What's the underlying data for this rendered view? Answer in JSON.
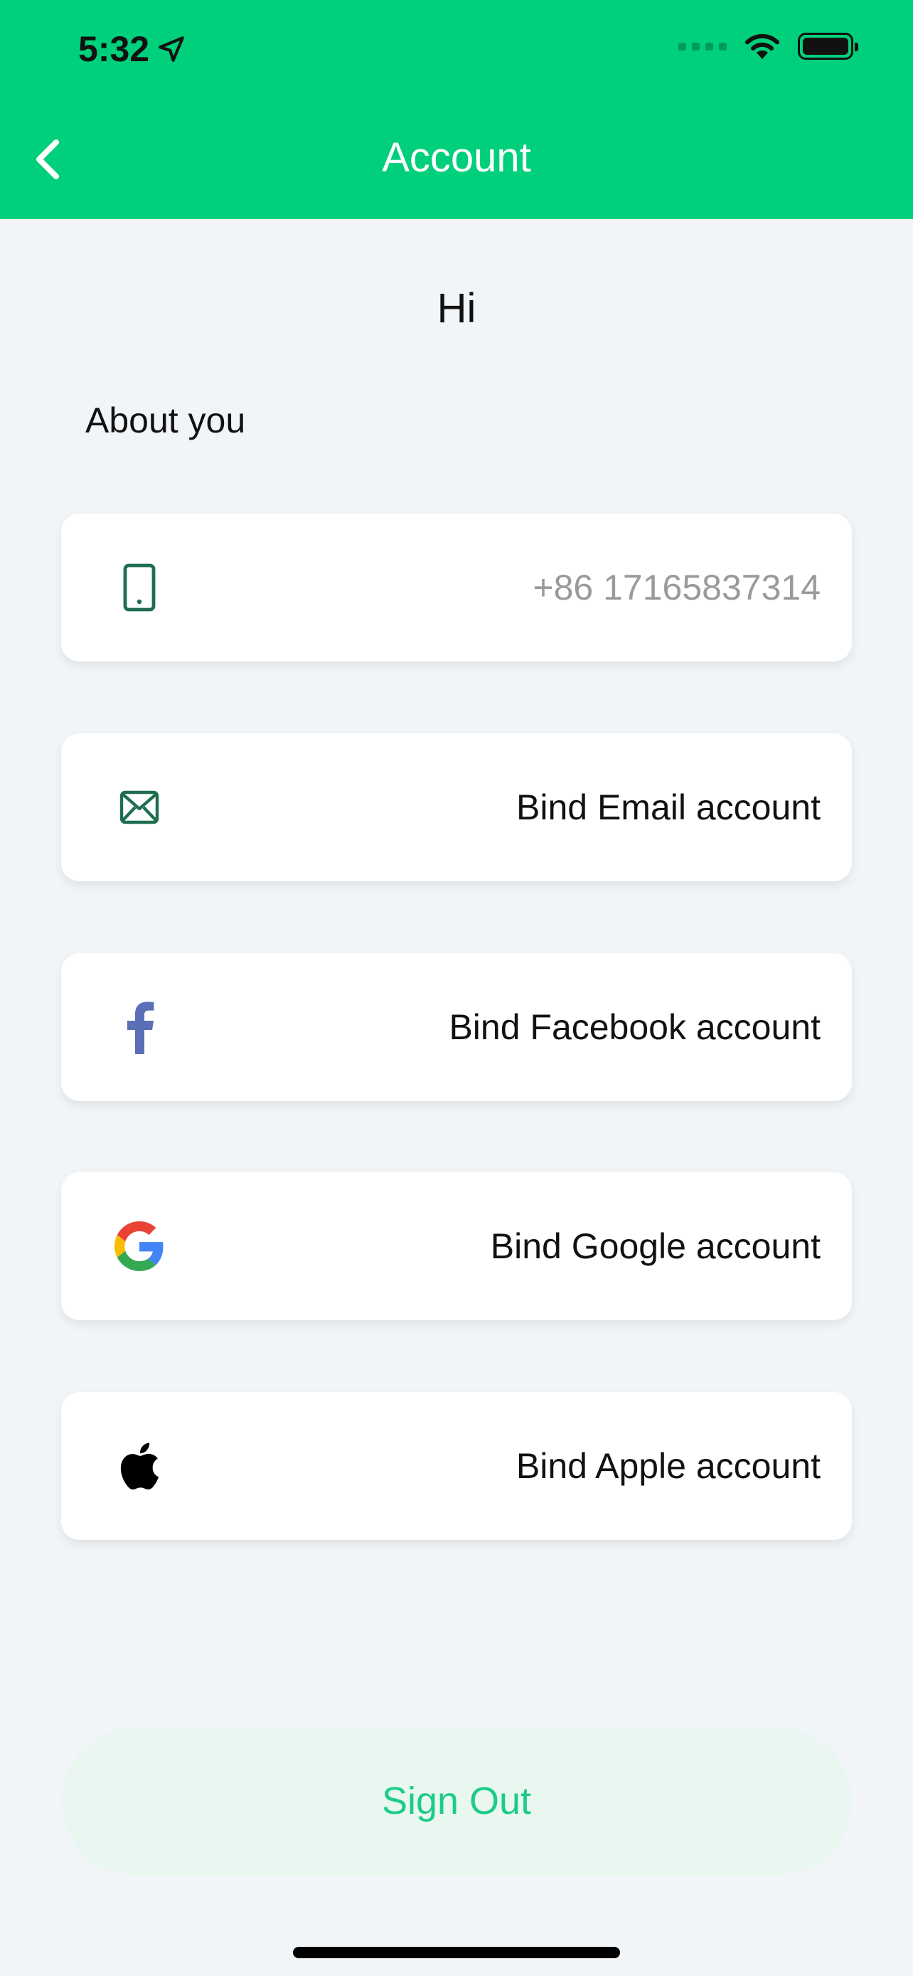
{
  "status_bar": {
    "time": "5:32"
  },
  "header": {
    "title": "Account",
    "back_icon": "chevron-left-icon"
  },
  "greeting": "Hi",
  "section_label": "About you",
  "accounts": [
    {
      "icon": "phone-icon",
      "label": "+86 17165837314"
    },
    {
      "icon": "mail-icon",
      "label": "Bind Email account"
    },
    {
      "icon": "facebook-icon",
      "label": "Bind Facebook account"
    },
    {
      "icon": "google-icon",
      "label": "Bind Google account"
    },
    {
      "icon": "apple-icon",
      "label": "Bind Apple account"
    }
  ],
  "signout_label": "Sign Out",
  "colors": {
    "brand_green": "#00cf7b",
    "background": "#f2f5f8",
    "icon_green": "#1f6d4f",
    "facebook_blue": "#5b6fb7",
    "signout_bg": "#eaf7f1",
    "signout_text": "#1dcc86"
  }
}
